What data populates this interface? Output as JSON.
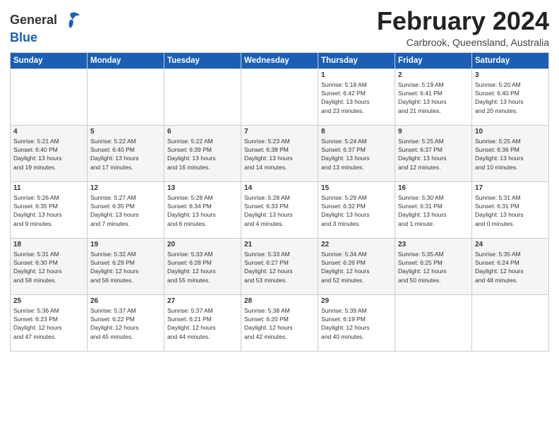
{
  "header": {
    "logo_general": "General",
    "logo_blue": "Blue",
    "month": "February 2024",
    "location": "Carbrook, Queensland, Australia"
  },
  "days_of_week": [
    "Sunday",
    "Monday",
    "Tuesday",
    "Wednesday",
    "Thursday",
    "Friday",
    "Saturday"
  ],
  "weeks": [
    [
      {
        "day": "",
        "info": ""
      },
      {
        "day": "",
        "info": ""
      },
      {
        "day": "",
        "info": ""
      },
      {
        "day": "",
        "info": ""
      },
      {
        "day": "1",
        "info": "Sunrise: 5:18 AM\nSunset: 6:42 PM\nDaylight: 13 hours\nand 23 minutes."
      },
      {
        "day": "2",
        "info": "Sunrise: 5:19 AM\nSunset: 6:41 PM\nDaylight: 13 hours\nand 21 minutes."
      },
      {
        "day": "3",
        "info": "Sunrise: 5:20 AM\nSunset: 6:40 PM\nDaylight: 13 hours\nand 20 minutes."
      }
    ],
    [
      {
        "day": "4",
        "info": "Sunrise: 5:21 AM\nSunset: 6:40 PM\nDaylight: 13 hours\nand 19 minutes."
      },
      {
        "day": "5",
        "info": "Sunrise: 5:22 AM\nSunset: 6:40 PM\nDaylight: 13 hours\nand 17 minutes."
      },
      {
        "day": "6",
        "info": "Sunrise: 5:22 AM\nSunset: 6:39 PM\nDaylight: 13 hours\nand 16 minutes."
      },
      {
        "day": "7",
        "info": "Sunrise: 5:23 AM\nSunset: 6:38 PM\nDaylight: 13 hours\nand 14 minutes."
      },
      {
        "day": "8",
        "info": "Sunrise: 5:24 AM\nSunset: 6:37 PM\nDaylight: 13 hours\nand 13 minutes."
      },
      {
        "day": "9",
        "info": "Sunrise: 5:25 AM\nSunset: 6:37 PM\nDaylight: 13 hours\nand 12 minutes."
      },
      {
        "day": "10",
        "info": "Sunrise: 5:25 AM\nSunset: 6:36 PM\nDaylight: 13 hours\nand 10 minutes."
      }
    ],
    [
      {
        "day": "11",
        "info": "Sunrise: 5:26 AM\nSunset: 6:35 PM\nDaylight: 13 hours\nand 9 minutes."
      },
      {
        "day": "12",
        "info": "Sunrise: 5:27 AM\nSunset: 6:35 PM\nDaylight: 13 hours\nand 7 minutes."
      },
      {
        "day": "13",
        "info": "Sunrise: 5:28 AM\nSunset: 6:34 PM\nDaylight: 13 hours\nand 6 minutes."
      },
      {
        "day": "14",
        "info": "Sunrise: 5:28 AM\nSunset: 6:33 PM\nDaylight: 13 hours\nand 4 minutes."
      },
      {
        "day": "15",
        "info": "Sunrise: 5:29 AM\nSunset: 6:32 PM\nDaylight: 13 hours\nand 3 minutes."
      },
      {
        "day": "16",
        "info": "Sunrise: 5:30 AM\nSunset: 6:31 PM\nDaylight: 13 hours\nand 1 minute."
      },
      {
        "day": "17",
        "info": "Sunrise: 5:31 AM\nSunset: 6:31 PM\nDaylight: 13 hours\nand 0 minutes."
      }
    ],
    [
      {
        "day": "18",
        "info": "Sunrise: 5:31 AM\nSunset: 6:30 PM\nDaylight: 12 hours\nand 58 minutes."
      },
      {
        "day": "19",
        "info": "Sunrise: 5:32 AM\nSunset: 6:29 PM\nDaylight: 12 hours\nand 56 minutes."
      },
      {
        "day": "20",
        "info": "Sunrise: 5:33 AM\nSunset: 6:28 PM\nDaylight: 12 hours\nand 55 minutes."
      },
      {
        "day": "21",
        "info": "Sunrise: 5:33 AM\nSunset: 6:27 PM\nDaylight: 12 hours\nand 53 minutes."
      },
      {
        "day": "22",
        "info": "Sunrise: 5:34 AM\nSunset: 6:26 PM\nDaylight: 12 hours\nand 52 minutes."
      },
      {
        "day": "23",
        "info": "Sunrise: 5:35 AM\nSunset: 6:25 PM\nDaylight: 12 hours\nand 50 minutes."
      },
      {
        "day": "24",
        "info": "Sunrise: 5:35 AM\nSunset: 6:24 PM\nDaylight: 12 hours\nand 48 minutes."
      }
    ],
    [
      {
        "day": "25",
        "info": "Sunrise: 5:36 AM\nSunset: 6:23 PM\nDaylight: 12 hours\nand 47 minutes."
      },
      {
        "day": "26",
        "info": "Sunrise: 5:37 AM\nSunset: 6:22 PM\nDaylight: 12 hours\nand 45 minutes."
      },
      {
        "day": "27",
        "info": "Sunrise: 5:37 AM\nSunset: 6:21 PM\nDaylight: 12 hours\nand 44 minutes."
      },
      {
        "day": "28",
        "info": "Sunrise: 5:38 AM\nSunset: 6:20 PM\nDaylight: 12 hours\nand 42 minutes."
      },
      {
        "day": "29",
        "info": "Sunrise: 5:39 AM\nSunset: 6:19 PM\nDaylight: 12 hours\nand 40 minutes."
      },
      {
        "day": "",
        "info": ""
      },
      {
        "day": "",
        "info": ""
      }
    ]
  ]
}
